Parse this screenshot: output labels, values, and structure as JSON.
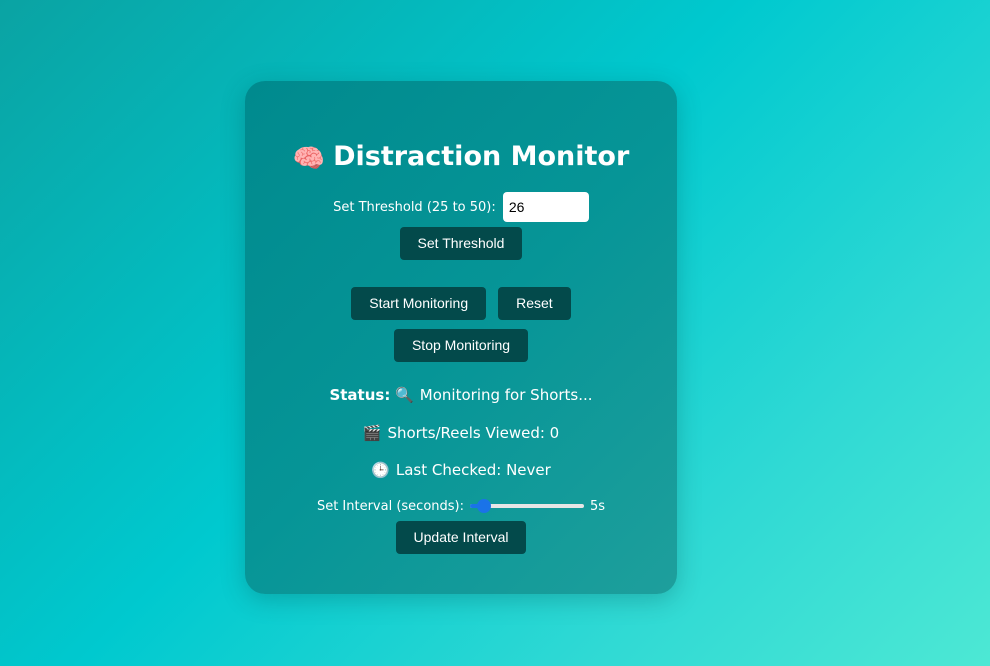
{
  "app": {
    "title": "Distraction Monitor",
    "title_icon": "🧠"
  },
  "threshold": {
    "label": "Set Threshold (25 to 50):",
    "value": "26",
    "button_label": "Set Threshold"
  },
  "controls": {
    "start_label": "Start Monitoring",
    "reset_label": "Reset",
    "stop_label": "Stop Monitoring"
  },
  "status": {
    "label": "Status:",
    "icon": "🔍",
    "text": "Monitoring for Shorts..."
  },
  "viewed": {
    "icon": "🎬",
    "text": "Shorts/Reels Viewed: 0"
  },
  "last_checked": {
    "icon": "🕒",
    "text": "Last Checked: Never"
  },
  "interval": {
    "label": "Set Interval (seconds):",
    "value": 5,
    "min": 1,
    "max": 60,
    "display": "5s",
    "button_label": "Update Interval"
  },
  "colors": {
    "button_bg": "#034a4b",
    "slider_accent": "#1a73e8"
  }
}
